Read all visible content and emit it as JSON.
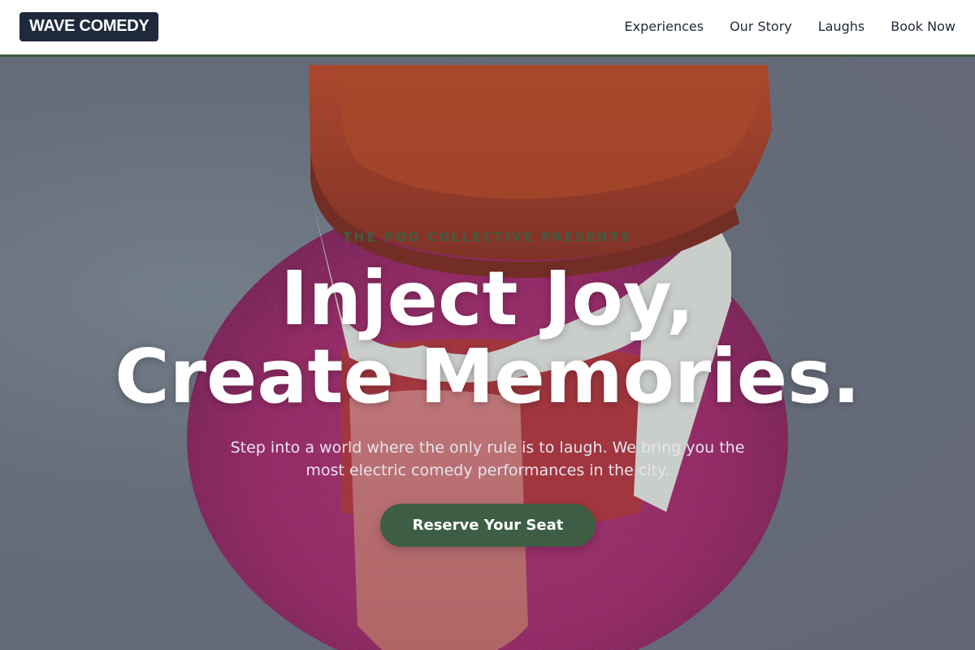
{
  "brand": {
    "logo_text": "WAVE COMEDY"
  },
  "nav": {
    "items": [
      {
        "label": "Experiences"
      },
      {
        "label": "Our Story"
      },
      {
        "label": "Laughs"
      },
      {
        "label": "Book Now"
      }
    ]
  },
  "hero": {
    "eyebrow": "THE POD COLLECTIVE PRESENTS",
    "headline_line1": "Inject Joy,",
    "headline_line2": "Create Memories.",
    "subtext": "Step into a world where the only rule is to laugh. We bring you the most electric comedy performances in the city.",
    "cta_label": "Reserve Your Seat",
    "background_image": "wind-up chattering teeth toy on pink textured surface"
  },
  "colors": {
    "accent": "#3d5e44",
    "logo_bg": "#1e293b",
    "nav_bg": "#ffffff",
    "headline": "#ffffff"
  }
}
